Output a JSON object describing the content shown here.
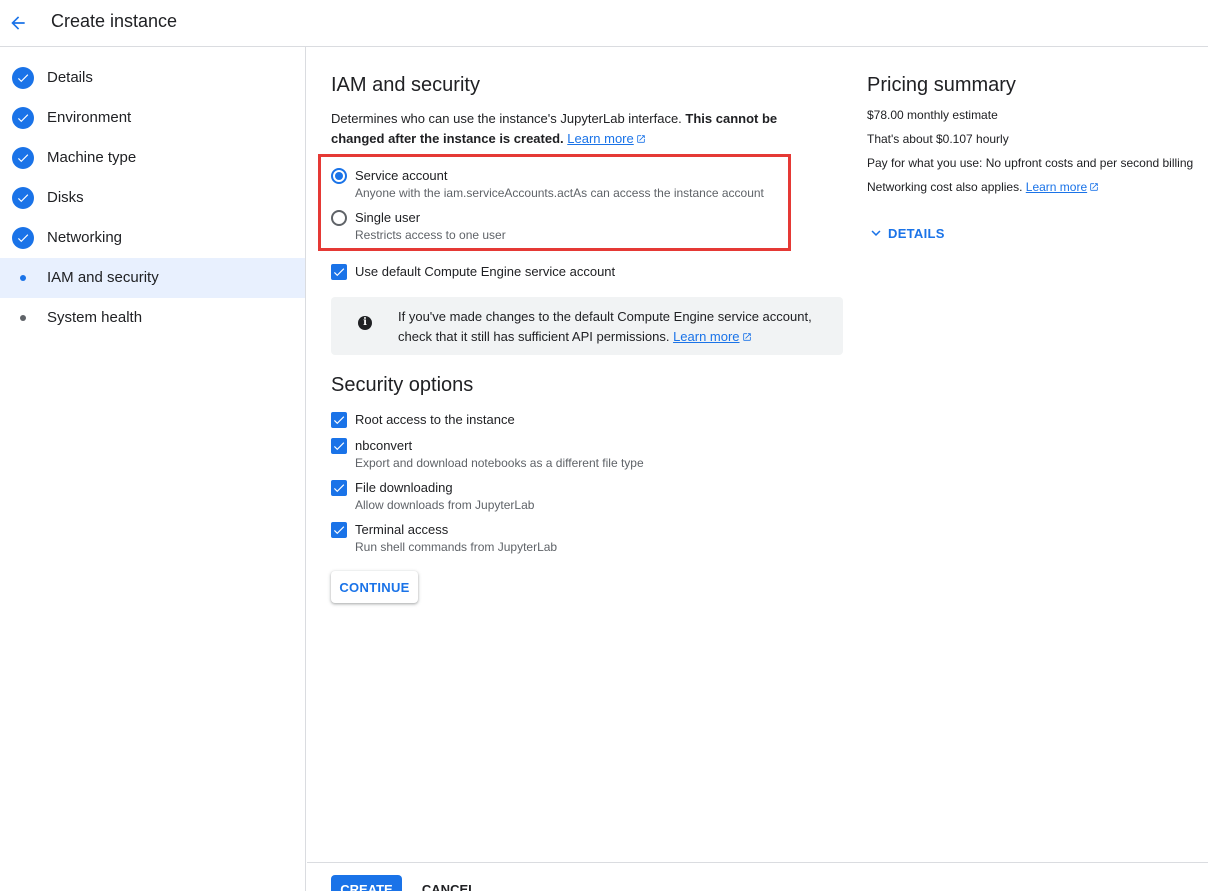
{
  "header": {
    "title": "Create instance",
    "back_icon": "arrow-back-icon"
  },
  "sidebar": {
    "items": [
      {
        "label": "Details",
        "state": "complete"
      },
      {
        "label": "Environment",
        "state": "complete"
      },
      {
        "label": "Machine type",
        "state": "complete"
      },
      {
        "label": "Disks",
        "state": "complete"
      },
      {
        "label": "Networking",
        "state": "complete"
      },
      {
        "label": "IAM and security",
        "state": "current"
      },
      {
        "label": "System health",
        "state": "pending"
      }
    ]
  },
  "main": {
    "title": "IAM and security",
    "description": "Determines who can use the instance's JupyterLab interface. ",
    "description_bold": "This cannot be changed after the instance is created.",
    "learn_more": "Learn more",
    "access_options": [
      {
        "label": "Service account",
        "sublabel": "Anyone with the iam.serviceAccounts.actAs can access the instance account",
        "selected": true
      },
      {
        "label": "Single user",
        "sublabel": "Restricts access to one user",
        "selected": false
      }
    ],
    "default_sa": {
      "label": "Use default Compute Engine service account",
      "checked": true
    },
    "info": {
      "text": "If you've made changes to the default Compute Engine service account, check that it still has sufficient API permissions.",
      "link": "Learn more"
    },
    "security_title": "Security options",
    "security_options": [
      {
        "label": "Root access to the instance",
        "sublabel": "",
        "checked": true
      },
      {
        "label": "nbconvert",
        "sublabel": "Export and download notebooks as a different file type",
        "checked": true
      },
      {
        "label": "File downloading",
        "sublabel": "Allow downloads from JupyterLab",
        "checked": true
      },
      {
        "label": "Terminal access",
        "sublabel": "Run shell commands from JupyterLab",
        "checked": true
      }
    ],
    "continue_label": "CONTINUE"
  },
  "pricing": {
    "title": "Pricing summary",
    "monthly": "$78.00 monthly estimate",
    "hourly": "That's about $0.107 hourly",
    "billing": "Pay for what you use: No upfront costs and per second billing",
    "networking": "Networking cost also applies.",
    "learn_more": "Learn more",
    "details_label": "DETAILS"
  },
  "footer": {
    "create_label": "CREATE",
    "cancel_label": "CANCEL"
  },
  "colors": {
    "accent": "#1a73e8",
    "highlight": "#e53935",
    "active_bg": "#e8f0fe",
    "pending_dot": "#5f6368"
  }
}
